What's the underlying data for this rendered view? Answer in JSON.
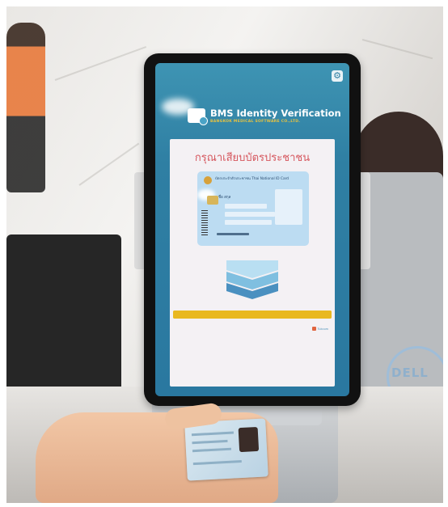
{
  "photo": {
    "description_free": true
  },
  "kiosk": {
    "brand_title": "BMS Identity Verification",
    "brand_subtitle": "BANGKOK MEDICAL SOFTWARE CO.,LTD.",
    "settings_icon": "gear-icon",
    "instruction": "กรุณาเสียบบัตรประชาชน",
    "id_card": {
      "title": "บัตรประจำตัวประชาชน Thai National ID Card",
      "name_line": "ชื่อ สกุล"
    },
    "progress_fraction": 1.0,
    "footer_logo_text": "Tukcom"
  },
  "monitor": {
    "brand": "DELL"
  },
  "colors": {
    "screen_bg": "#2f7fa3",
    "panel_bg": "#f4f1f4",
    "instruction_text": "#d6585f",
    "progress": "#f1c83a",
    "brand_sub": "#e8c240"
  }
}
